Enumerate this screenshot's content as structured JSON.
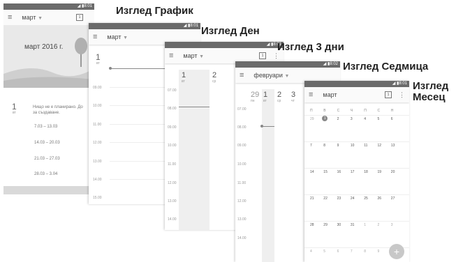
{
  "captions": {
    "schedule": "Изглед График",
    "day": "Изглед Ден",
    "three_days": "Изглед 3 дни",
    "week": "Изглед Седмица",
    "month": "Изглед Месец"
  },
  "status": {
    "time1": "8:01",
    "time2": "8:01",
    "time3": "8:01",
    "time4": "8:02",
    "time5": "8:01"
  },
  "schedule": {
    "month": "март",
    "banner": "март 2016 г.",
    "day_num": "1",
    "day_name": "вт",
    "empty_text": "Нищо не е планирано. До",
    "empty_text2": "за създаване.",
    "weeks": [
      "7.03 – 13.03",
      "14.03 – 20.03",
      "21.03 – 27.03",
      "28.03 – 3.04"
    ]
  },
  "day": {
    "month": "март",
    "day_num": "1",
    "day_name": "вт",
    "hours": [
      "09.00",
      "10.00",
      "11.00",
      "12.00",
      "13.00",
      "14.00",
      "15.00"
    ]
  },
  "three": {
    "month": "март",
    "days": [
      {
        "n": "1",
        "d": "вт"
      },
      {
        "n": "2",
        "d": "ср"
      }
    ],
    "hours": [
      "07.00",
      "08.00",
      "09.00",
      "10.00",
      "11.00",
      "12.00",
      "13.00",
      "14.00"
    ]
  },
  "week": {
    "month": "февруари",
    "days": [
      {
        "n": "29",
        "d": "пн"
      },
      {
        "n": "1",
        "d": "вт"
      },
      {
        "n": "2",
        "d": "ср"
      },
      {
        "n": "3",
        "d": "чт"
      }
    ],
    "hours": [
      "07.00",
      "08.00",
      "09.00",
      "10.00",
      "11.00",
      "12.00",
      "13.00",
      "14.00"
    ]
  },
  "month": {
    "title": "март",
    "weekdays": [
      "П",
      "В",
      "С",
      "Ч",
      "П",
      "С",
      "Н"
    ],
    "rows": [
      [
        "29",
        "1",
        "2",
        "3",
        "4",
        "5",
        "6"
      ],
      [
        "7",
        "8",
        "9",
        "10",
        "11",
        "12",
        "13"
      ],
      [
        "14",
        "15",
        "16",
        "17",
        "18",
        "19",
        "20"
      ],
      [
        "21",
        "22",
        "23",
        "24",
        "25",
        "26",
        "27"
      ],
      [
        "28",
        "29",
        "30",
        "31",
        "1",
        "2",
        "3"
      ],
      [
        "4",
        "5",
        "6",
        "7",
        "8",
        "9",
        "10"
      ]
    ],
    "fab": "+"
  }
}
